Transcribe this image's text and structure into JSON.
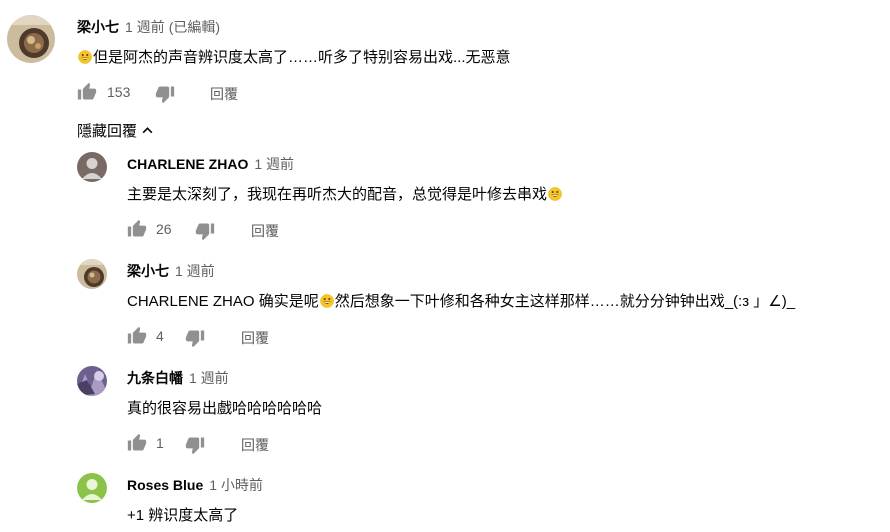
{
  "comments": [
    {
      "author": "梁小七",
      "time": "1 週前",
      "edited": "(已編輯)",
      "text_before": "",
      "text_after": "但是阿杰的声音辨识度太高了……听多了特别容易出戏...无恶意",
      "likes": "153",
      "reply_label": "回覆"
    },
    {
      "author": "CHARLENE ZHAO",
      "time": "1 週前",
      "text_before": "主要是太深刻了，我现在再听杰大的配音，总觉得是叶修去串戏",
      "text_after": "",
      "likes": "26",
      "reply_label": "回覆"
    },
    {
      "author": "梁小七",
      "time": "1 週前",
      "text_before": "CHARLENE ZHAO 确实是呢",
      "text_after": "然后想象一下叶修和各种女主这样那样……就分分钟钟出戏_(:з 」∠)_",
      "likes": "4",
      "reply_label": "回覆"
    },
    {
      "author": "九条白幡",
      "time": "1 週前",
      "text_before": "真的很容易出戲哈哈哈哈哈哈",
      "text_after": "",
      "likes": "1",
      "reply_label": "回覆"
    },
    {
      "author": "Roses Blue",
      "time": "1 小時前",
      "text_before": "+1 辨识度太高了",
      "text_after": ""
    }
  ],
  "hide_replies_label": "隱藏回覆",
  "icons": {
    "like": "thumb-up-icon",
    "dislike": "thumb-down-icon",
    "emoji": "grinning-face-emoji-icon",
    "chevron": "chevron-up-icon"
  },
  "colors": {
    "meta_gray": "#606060",
    "icon_gray": "#909090",
    "avatar_green": "#8bc34a",
    "avatar_mauve": "#8d6e63"
  }
}
